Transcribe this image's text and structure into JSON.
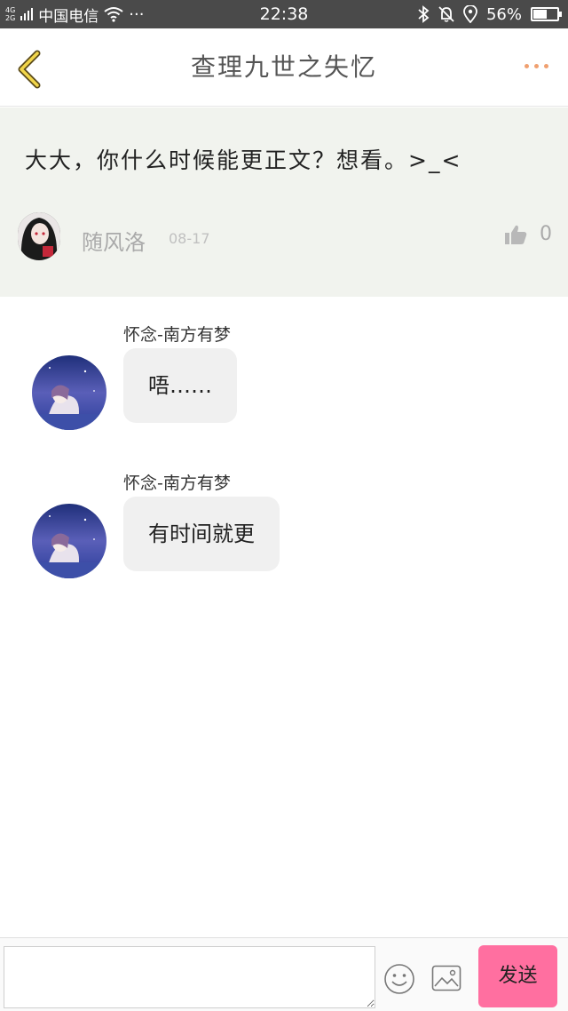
{
  "status_bar": {
    "network_top": "4G",
    "network_bottom": "2G",
    "carrier": "中国电信",
    "dots": "···",
    "time": "22:38",
    "battery_text": "56%",
    "battery_level": 0.56
  },
  "header": {
    "title": "查理九世之失忆"
  },
  "post": {
    "text": "大大，你什么时候能更正文？想看。>_<",
    "author": "随风洛",
    "date": "08-17",
    "like_count": "0"
  },
  "comments": [
    {
      "name": "怀念-南方有梦",
      "text": "唔……"
    },
    {
      "name": "怀念-南方有梦",
      "text": "有时间就更"
    }
  ],
  "input_bar": {
    "placeholder": "",
    "send_label": "发送",
    "send_color": "#ff6fa0"
  }
}
